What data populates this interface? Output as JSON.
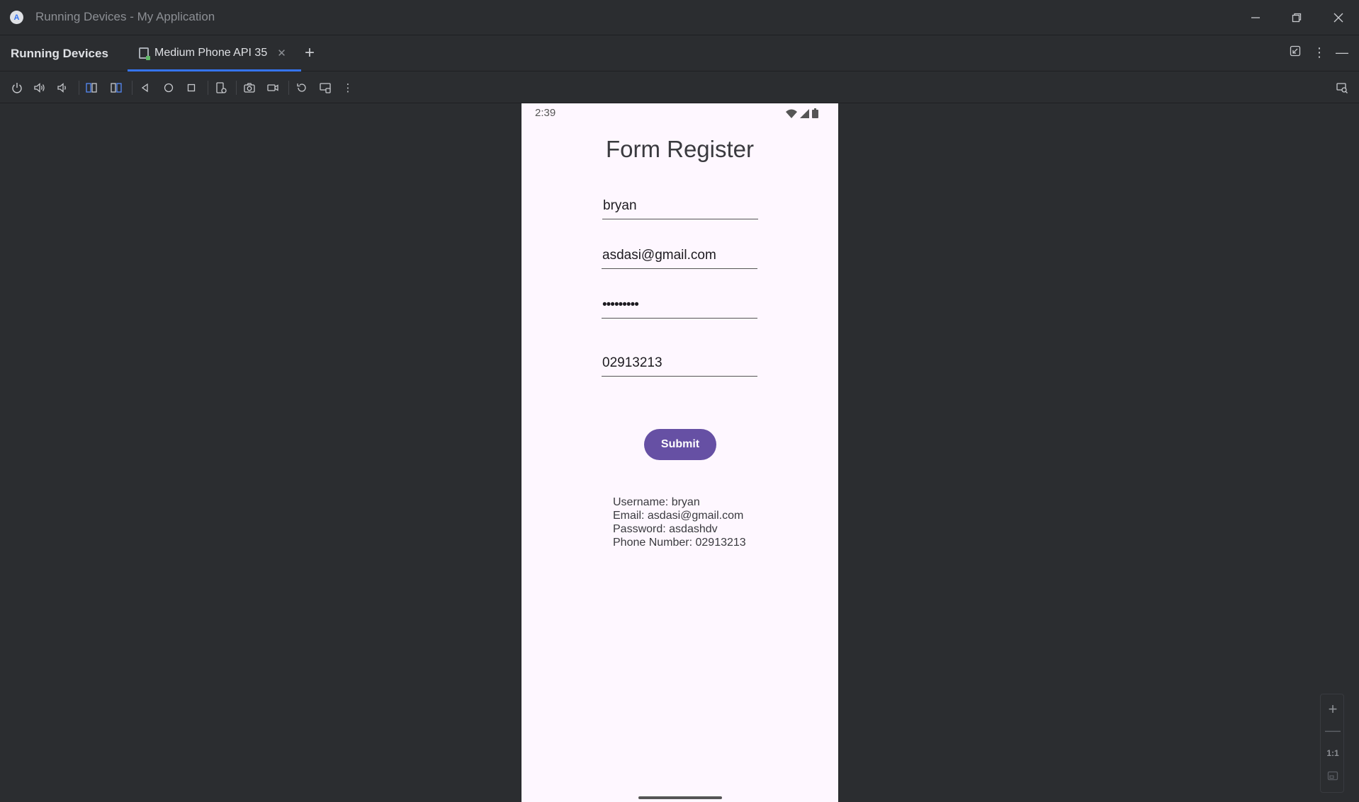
{
  "window": {
    "title": "Running Devices - My Application",
    "controls": {
      "minimize_icon": "minimize-icon",
      "restore_icon": "restore-icon",
      "close_icon": "close-icon"
    }
  },
  "toolwindow": {
    "title": "Running Devices",
    "tabs": [
      {
        "label": "Medium Phone API 35",
        "active": true
      }
    ],
    "add_tab_icon": "plus-icon"
  },
  "toolbar": {
    "icons": [
      "power-icon",
      "volume-up-icon",
      "volume-down-icon",
      "rotate-left-icon",
      "rotate-right-icon",
      "back-icon",
      "home-icon",
      "overview-icon",
      "device-settings-icon",
      "screenshot-icon",
      "screen-record-icon",
      "reset-icon",
      "keyboard-icon",
      "more-icon"
    ]
  },
  "device": {
    "status_time": "2:39",
    "form": {
      "title": "Form Register",
      "username_value": "bryan",
      "email_value": "asdasi@gmail.com",
      "password_value": "•••••••••",
      "phone_value": "02913213",
      "submit_label": "Submit"
    },
    "result": {
      "username": "Username: bryan",
      "email": "Email: asdasi@gmail.com",
      "password": "Password: asdashdv",
      "phone": "Phone Number: 02913213"
    }
  },
  "zoom": {
    "one_to_one": "1:1"
  },
  "colors": {
    "accent": "#3574f0",
    "button": "#6650a4",
    "phone_bg": "#fef7ff",
    "ide_bg": "#2b2d30"
  }
}
